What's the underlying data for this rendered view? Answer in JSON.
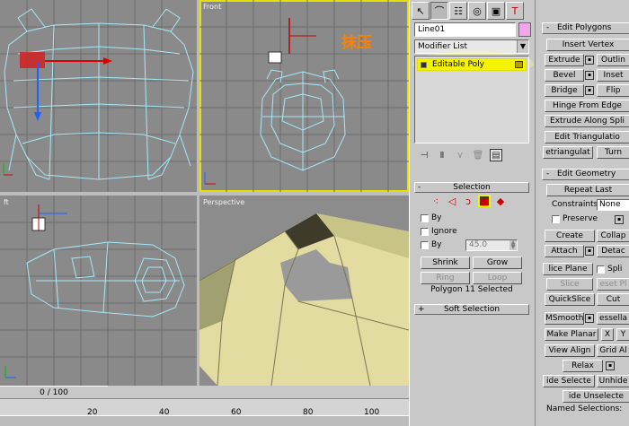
{
  "viewports": {
    "top": {
      "label": ""
    },
    "front": {
      "label": "Front"
    },
    "left": {
      "label": "ft"
    },
    "perspective": {
      "label": "Perspective"
    }
  },
  "annotation": {
    "text": "抹压"
  },
  "timeline": {
    "frame_counter": "0 / 100",
    "ticks": [
      "20",
      "40",
      "60",
      "80",
      "100"
    ]
  },
  "command_panel": {
    "object_name": "Line01",
    "object_color": "#f0a6e8",
    "modifier_list": "Modifier List",
    "stack": [
      {
        "label": "Editable Poly"
      }
    ],
    "tabs": [
      "pointer-icon",
      "bend-icon",
      "hierarchy-icon",
      "motion-icon",
      "display-icon",
      "utilities-icon"
    ],
    "selection": {
      "title": "Selection",
      "by_vertex": "By",
      "ignore": "Ignore",
      "by_angle": "By",
      "angle_value": "45.0",
      "shrink": "Shrink",
      "grow": "Grow",
      "ring": "Ring",
      "loop": "Loop",
      "status": "Polygon 11 Selected"
    },
    "soft_selection": {
      "title": "Soft Selection"
    }
  },
  "edit_polygons": {
    "title": "Edit Polygons",
    "insert_vertex": "Insert Vertex",
    "extrude": "Extrude",
    "outline": "Outlin",
    "bevel": "Bevel",
    "inset": "Inset",
    "bridge": "Bridge",
    "flip": "Flip",
    "hinge": "Hinge From Edge",
    "extrude_spline": "Extrude Along Spli",
    "edit_triangulation": "Edit Triangulatio",
    "retriangulate": "etriangulat",
    "turn": "Turn"
  },
  "edit_geometry": {
    "title": "Edit Geometry",
    "repeat_last": "Repeat Last",
    "constraints_label": "Constraints:",
    "constraints_value": "None",
    "preserve": "Preserve",
    "create": "Create",
    "collapse": "Collap",
    "attach": "Attach",
    "detach": "Detac",
    "slice_plane": "lice Plane",
    "split": "Spli",
    "slice": "Slice",
    "reset_plane": "eset Pl",
    "quickslice": "QuickSlice",
    "cut": "Cut",
    "msmooth": "MSmooth",
    "tessellate": "essella",
    "make_planar": "Make Planar",
    "x": "X",
    "y": "Y",
    "view_align": "View Align",
    "grid_align": "Grid Al",
    "relax": "Relax",
    "hide_selected": "ide Selecte",
    "unhide": "Unhide",
    "hide_unselected": "ide Unselecte",
    "named_selections": "Named Selections:"
  }
}
